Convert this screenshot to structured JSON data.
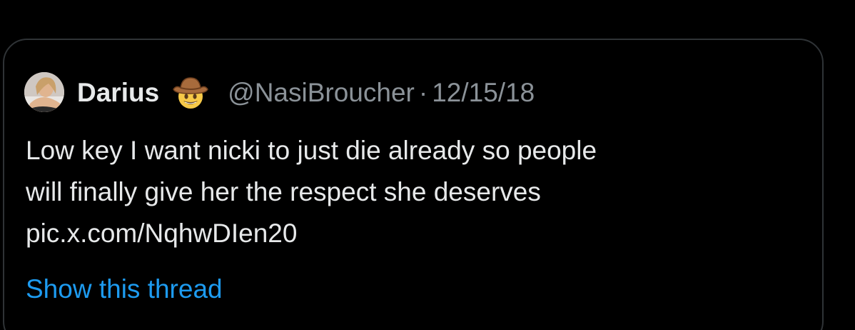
{
  "quoted_tweet": {
    "author": {
      "display_name": "Darius",
      "emoji_icon": "cowboy-hat-face-icon",
      "handle": "@NasiBroucher",
      "separator": "·",
      "date": "12/15/18"
    },
    "text_lines": [
      "Low key I want nicki to just die already so people",
      "will finally give her the respect she deserves",
      "pic.x.com/NqhwDIen20"
    ],
    "show_thread_label": "Show this thread"
  },
  "colors": {
    "background": "#000000",
    "card_border": "#2f3336",
    "primary_text": "#e7e9ea",
    "secondary_text": "#8b9298",
    "link": "#1d9bf0"
  }
}
